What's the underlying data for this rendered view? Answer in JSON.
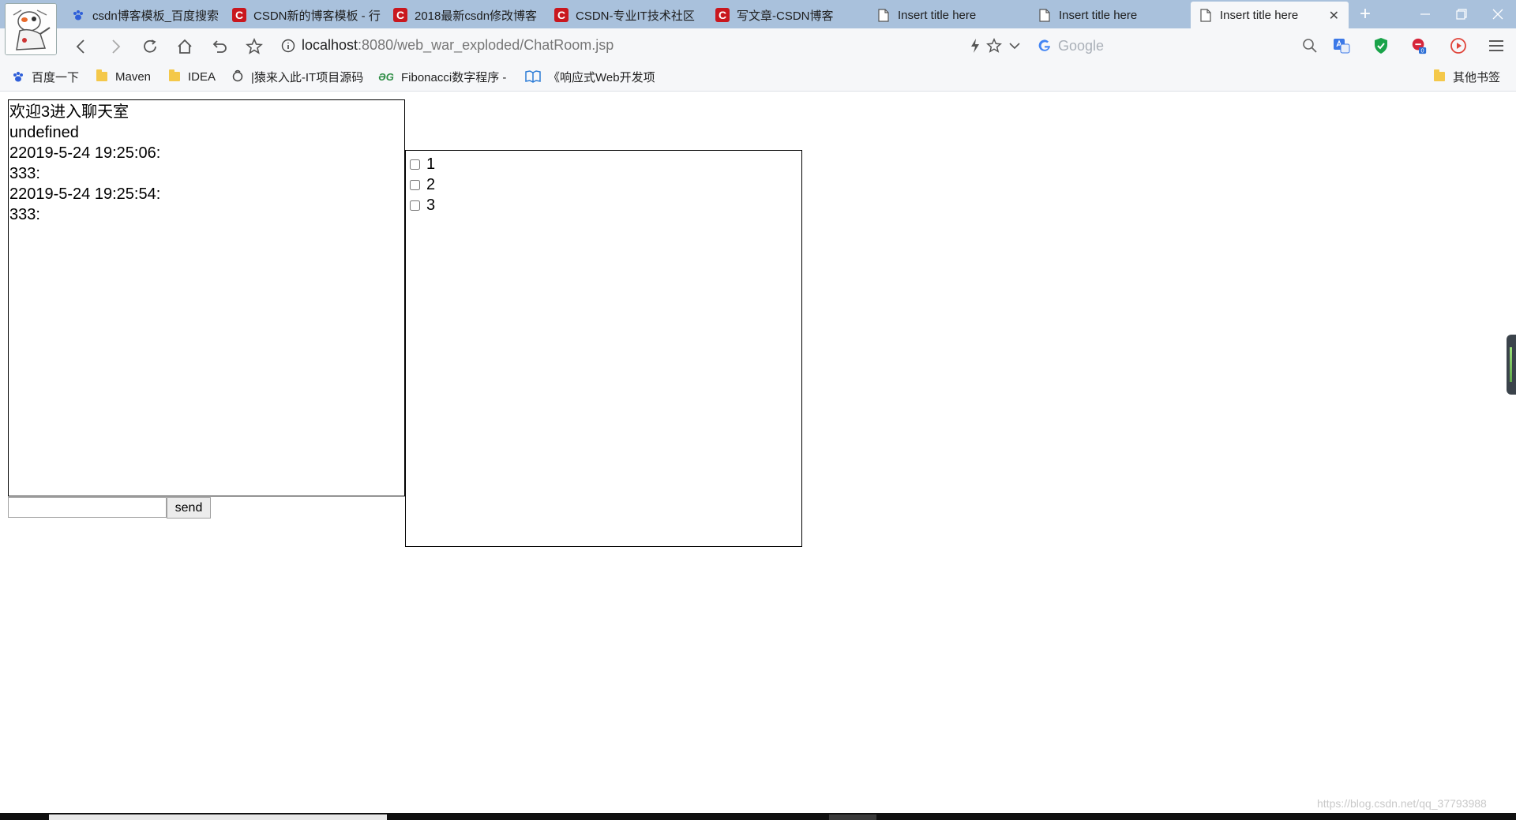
{
  "browser": {
    "tabs": [
      {
        "title": "csdn博客模板_百度搜索",
        "icon": "baidu-paw-icon",
        "active": false
      },
      {
        "title": "CSDN新的博客模板 - 行",
        "icon": "csdn-icon",
        "active": false
      },
      {
        "title": "2018最新csdn修改博客",
        "icon": "csdn-icon",
        "active": false
      },
      {
        "title": "CSDN-专业IT技术社区",
        "icon": "csdn-icon",
        "active": false
      },
      {
        "title": "写文章-CSDN博客",
        "icon": "csdn-icon",
        "active": false
      },
      {
        "title": "Insert title here",
        "icon": "page-icon",
        "active": false
      },
      {
        "title": "Insert title here",
        "icon": "page-icon",
        "active": false
      },
      {
        "title": "Insert title here",
        "icon": "page-icon",
        "active": true
      }
    ],
    "address": {
      "host": "localhost",
      "path": ":8080/web_war_exploded/ChatRoom.jsp"
    },
    "search": {
      "placeholder": "Google"
    },
    "bookmarks": [
      {
        "label": "百度一下",
        "icon": "baidu-paw-icon"
      },
      {
        "label": "Maven",
        "icon": "folder-icon"
      },
      {
        "label": "IDEA",
        "icon": "folder-icon"
      },
      {
        "label": "|猿来入此-IT项目源码",
        "icon": "monkey-icon"
      },
      {
        "label": "Fibonacci数字程序 -",
        "icon": "gg-icon"
      },
      {
        "label": "《响应式Web开发项",
        "icon": "book-icon"
      },
      {
        "label": "其他书签",
        "icon": "folder-icon"
      }
    ]
  },
  "chat": {
    "lines": [
      "欢迎3进入聊天室",
      "undefined",
      "22019-5-24 19:25:06:",
      "333:",
      "",
      "22019-5-24 19:25:54:",
      "333:"
    ],
    "send_label": "send",
    "message_value": ""
  },
  "users": [
    {
      "label": "1",
      "checked": false
    },
    {
      "label": "2",
      "checked": false
    },
    {
      "label": "3",
      "checked": false
    }
  ],
  "watermark": "https://blog.csdn.net/qq_37793988"
}
